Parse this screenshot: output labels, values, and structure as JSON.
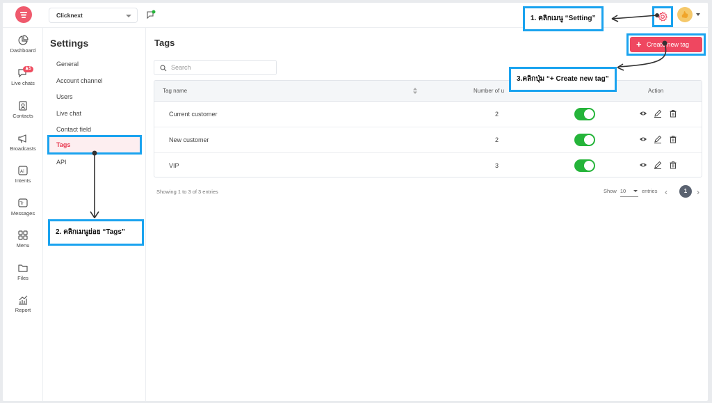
{
  "topbar": {
    "workspace": "Clicknext"
  },
  "rail": {
    "items": [
      {
        "label": "Dashboard",
        "icon": "dashboard-icon"
      },
      {
        "label": "Live chats",
        "icon": "chat-icon",
        "badge": "♟5"
      },
      {
        "label": "Contacts",
        "icon": "contacts-icon"
      },
      {
        "label": "Broadcasts",
        "icon": "megaphone-icon"
      },
      {
        "label": "Intents",
        "icon": "ai-icon"
      },
      {
        "label": "Messages",
        "icon": "messages-icon"
      },
      {
        "label": "Menu",
        "icon": "grid-icon"
      },
      {
        "label": "Files",
        "icon": "folder-icon"
      },
      {
        "label": "Report",
        "icon": "report-icon"
      }
    ]
  },
  "settings": {
    "title": "Settings",
    "items": [
      "General",
      "Account channel",
      "Users",
      "Live chat",
      "Contact field",
      "Tags",
      "API"
    ],
    "active": "Tags"
  },
  "main": {
    "title": "Tags",
    "create_button": "Create new tag",
    "search_placeholder": "Search",
    "columns": [
      "Tag name",
      "Number of u",
      "Action"
    ],
    "rows": [
      {
        "name": "Current customer",
        "count": "2",
        "enabled": true
      },
      {
        "name": "New customer",
        "count": "2",
        "enabled": true
      },
      {
        "name": "VIP",
        "count": "3",
        "enabled": true
      }
    ],
    "footer_info": "Showing 1 to 3 of 3 entries",
    "show_label": "Show",
    "page_size": "10",
    "entries_label": "entries",
    "current_page": "1"
  },
  "annotations": {
    "step1": "1. คลิกเมนู “Setting”",
    "step2": "2. คลิกเมนูย่อย “Tags”",
    "step3": "3.คลิกปุ่ม “+ Create new tag”"
  },
  "colors": {
    "accent": "#ef4760",
    "callout_border": "#1aa3ef",
    "toggle_on": "#25b43a"
  }
}
